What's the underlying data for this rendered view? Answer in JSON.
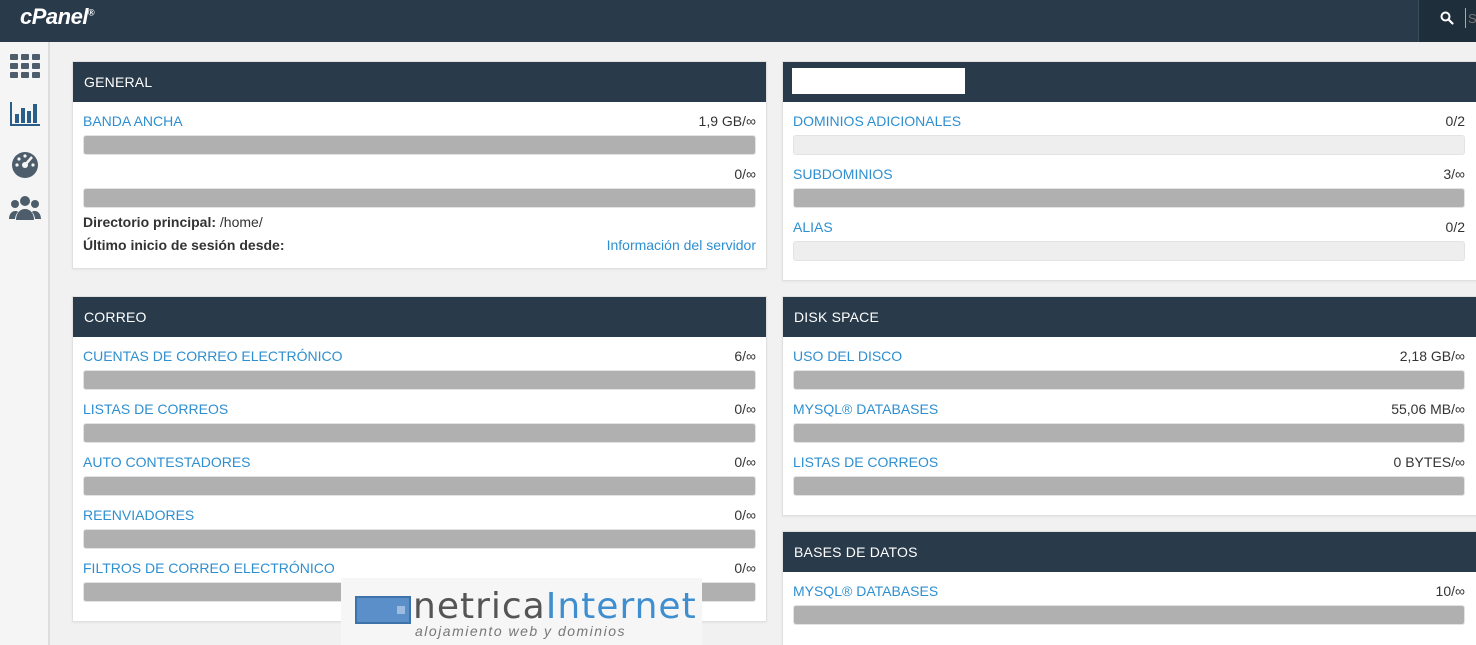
{
  "header": {
    "logo_text": "cPanel",
    "logo_mark": "®",
    "search_placeholder": "Se"
  },
  "sidebar": {
    "icons": [
      "grid-icon",
      "stats-chart-icon",
      "dashboard-gauge-icon",
      "users-icon"
    ]
  },
  "panels": {
    "general": {
      "title": "GENERAL",
      "rows": [
        {
          "label": "BANDA ANCHA",
          "value": "1,9 GB/∞",
          "fill": 1.0
        },
        {
          "label": "",
          "value": "0/∞",
          "fill": 1.0
        }
      ],
      "home_label": "Directorio principal:",
      "home_value": "/home/",
      "last_login_label": "Último inicio de sesión desde:",
      "server_info_link": "Información del servidor"
    },
    "domains": {
      "title": "",
      "rows": [
        {
          "label": "DOMINIOS ADICIONALES",
          "value": "0/2",
          "fill": 0.0
        },
        {
          "label": "SUBDOMINIOS",
          "value": "3/∞",
          "fill": 1.0
        },
        {
          "label": "ALIAS",
          "value": "0/2",
          "fill": 0.0
        }
      ]
    },
    "correo": {
      "title": "CORREO",
      "rows": [
        {
          "label": "CUENTAS DE CORREO ELECTRÓNICO",
          "value": "6/∞",
          "fill": 1.0
        },
        {
          "label": "LISTAS DE CORREOS",
          "value": "0/∞",
          "fill": 1.0
        },
        {
          "label": "AUTO CONTESTADORES",
          "value": "0/∞",
          "fill": 1.0
        },
        {
          "label": "REENVIADORES",
          "value": "0/∞",
          "fill": 1.0
        },
        {
          "label": "FILTROS DE CORREO ELECTRÓNICO",
          "value": "0/∞",
          "fill": 1.0
        }
      ]
    },
    "disk": {
      "title": "DISK SPACE",
      "rows": [
        {
          "label": "USO DEL DISCO",
          "value": "2,18 GB/∞",
          "fill": 1.0
        },
        {
          "label": "MYSQL® DATABASES",
          "value": "55,06 MB/∞",
          "fill": 1.0
        },
        {
          "label": "LISTAS DE CORREOS",
          "value": "0 BYTES/∞",
          "fill": 1.0
        }
      ]
    },
    "databases": {
      "title": "BASES DE DATOS",
      "rows": [
        {
          "label": "MYSQL® DATABASES",
          "value": "10/∞",
          "fill": 1.0
        }
      ]
    }
  },
  "watermark": {
    "brand_a": "netrica",
    "brand_b": "Internet",
    "tagline": "alojamiento web y dominios"
  },
  "colors": {
    "header_bg": "#293a4a",
    "link": "#2e8fd0",
    "bar_fill": "#b0b0b0"
  }
}
